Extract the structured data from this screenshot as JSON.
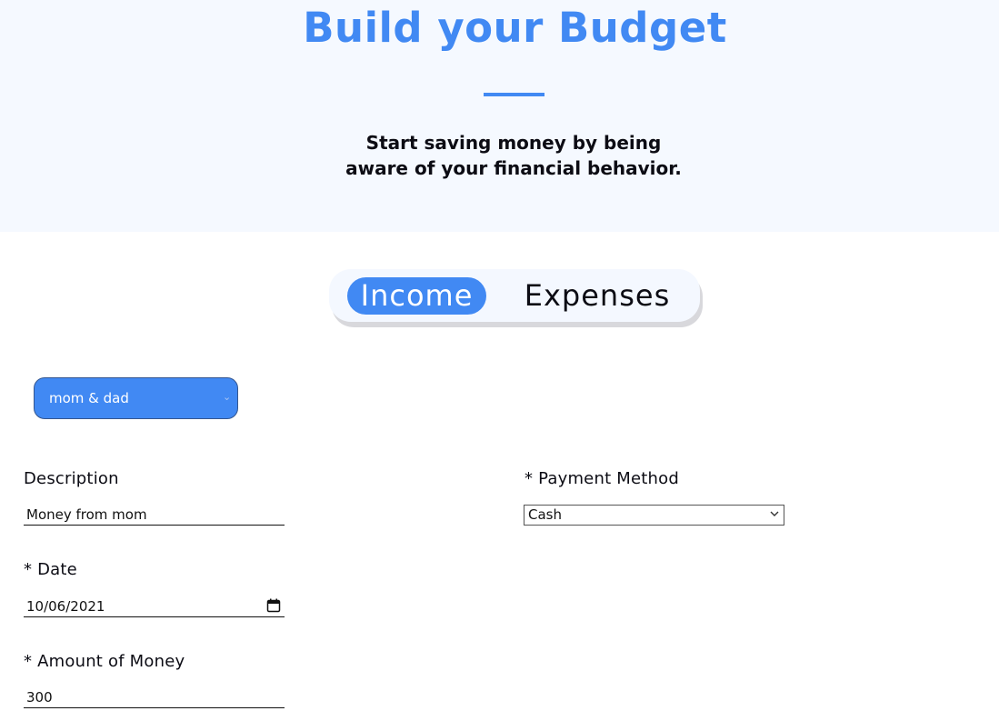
{
  "hero": {
    "title": "Build your Budget",
    "subtitle_line1": "Start saving money by being",
    "subtitle_line2": "aware of your financial behavior."
  },
  "tabs": [
    {
      "label": "Income",
      "active": true
    },
    {
      "label": "Expenses",
      "active": false
    }
  ],
  "income_source": {
    "selected": "mom & dad"
  },
  "form": {
    "description": {
      "label": "Description",
      "value": "Money from mom"
    },
    "payment_method": {
      "label": "* Payment Method",
      "value": "Cash"
    },
    "date": {
      "label": "* Date",
      "value": "10/06/2021"
    },
    "amount": {
      "label": "* Amount of Money",
      "value": "300"
    }
  },
  "colors": {
    "accent": "#4189f3",
    "hero_bg": "#f5f9ff",
    "toggle_bg": "#f4f8ff"
  }
}
